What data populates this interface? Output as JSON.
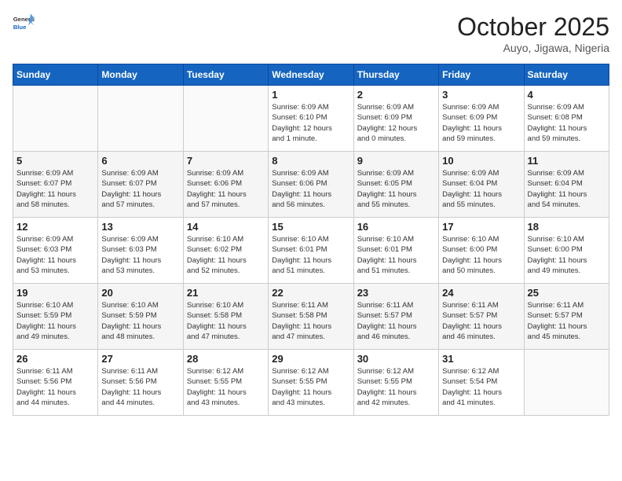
{
  "header": {
    "logo_line1": "General",
    "logo_line2": "Blue",
    "month": "October 2025",
    "location": "Auyo, Jigawa, Nigeria"
  },
  "days_of_week": [
    "Sunday",
    "Monday",
    "Tuesday",
    "Wednesday",
    "Thursday",
    "Friday",
    "Saturday"
  ],
  "weeks": [
    [
      {
        "day": "",
        "info": ""
      },
      {
        "day": "",
        "info": ""
      },
      {
        "day": "",
        "info": ""
      },
      {
        "day": "1",
        "info": "Sunrise: 6:09 AM\nSunset: 6:10 PM\nDaylight: 12 hours\nand 1 minute."
      },
      {
        "day": "2",
        "info": "Sunrise: 6:09 AM\nSunset: 6:09 PM\nDaylight: 12 hours\nand 0 minutes."
      },
      {
        "day": "3",
        "info": "Sunrise: 6:09 AM\nSunset: 6:09 PM\nDaylight: 11 hours\nand 59 minutes."
      },
      {
        "day": "4",
        "info": "Sunrise: 6:09 AM\nSunset: 6:08 PM\nDaylight: 11 hours\nand 59 minutes."
      }
    ],
    [
      {
        "day": "5",
        "info": "Sunrise: 6:09 AM\nSunset: 6:07 PM\nDaylight: 11 hours\nand 58 minutes."
      },
      {
        "day": "6",
        "info": "Sunrise: 6:09 AM\nSunset: 6:07 PM\nDaylight: 11 hours\nand 57 minutes."
      },
      {
        "day": "7",
        "info": "Sunrise: 6:09 AM\nSunset: 6:06 PM\nDaylight: 11 hours\nand 57 minutes."
      },
      {
        "day": "8",
        "info": "Sunrise: 6:09 AM\nSunset: 6:06 PM\nDaylight: 11 hours\nand 56 minutes."
      },
      {
        "day": "9",
        "info": "Sunrise: 6:09 AM\nSunset: 6:05 PM\nDaylight: 11 hours\nand 55 minutes."
      },
      {
        "day": "10",
        "info": "Sunrise: 6:09 AM\nSunset: 6:04 PM\nDaylight: 11 hours\nand 55 minutes."
      },
      {
        "day": "11",
        "info": "Sunrise: 6:09 AM\nSunset: 6:04 PM\nDaylight: 11 hours\nand 54 minutes."
      }
    ],
    [
      {
        "day": "12",
        "info": "Sunrise: 6:09 AM\nSunset: 6:03 PM\nDaylight: 11 hours\nand 53 minutes."
      },
      {
        "day": "13",
        "info": "Sunrise: 6:09 AM\nSunset: 6:03 PM\nDaylight: 11 hours\nand 53 minutes."
      },
      {
        "day": "14",
        "info": "Sunrise: 6:10 AM\nSunset: 6:02 PM\nDaylight: 11 hours\nand 52 minutes."
      },
      {
        "day": "15",
        "info": "Sunrise: 6:10 AM\nSunset: 6:01 PM\nDaylight: 11 hours\nand 51 minutes."
      },
      {
        "day": "16",
        "info": "Sunrise: 6:10 AM\nSunset: 6:01 PM\nDaylight: 11 hours\nand 51 minutes."
      },
      {
        "day": "17",
        "info": "Sunrise: 6:10 AM\nSunset: 6:00 PM\nDaylight: 11 hours\nand 50 minutes."
      },
      {
        "day": "18",
        "info": "Sunrise: 6:10 AM\nSunset: 6:00 PM\nDaylight: 11 hours\nand 49 minutes."
      }
    ],
    [
      {
        "day": "19",
        "info": "Sunrise: 6:10 AM\nSunset: 5:59 PM\nDaylight: 11 hours\nand 49 minutes."
      },
      {
        "day": "20",
        "info": "Sunrise: 6:10 AM\nSunset: 5:59 PM\nDaylight: 11 hours\nand 48 minutes."
      },
      {
        "day": "21",
        "info": "Sunrise: 6:10 AM\nSunset: 5:58 PM\nDaylight: 11 hours\nand 47 minutes."
      },
      {
        "day": "22",
        "info": "Sunrise: 6:11 AM\nSunset: 5:58 PM\nDaylight: 11 hours\nand 47 minutes."
      },
      {
        "day": "23",
        "info": "Sunrise: 6:11 AM\nSunset: 5:57 PM\nDaylight: 11 hours\nand 46 minutes."
      },
      {
        "day": "24",
        "info": "Sunrise: 6:11 AM\nSunset: 5:57 PM\nDaylight: 11 hours\nand 46 minutes."
      },
      {
        "day": "25",
        "info": "Sunrise: 6:11 AM\nSunset: 5:57 PM\nDaylight: 11 hours\nand 45 minutes."
      }
    ],
    [
      {
        "day": "26",
        "info": "Sunrise: 6:11 AM\nSunset: 5:56 PM\nDaylight: 11 hours\nand 44 minutes."
      },
      {
        "day": "27",
        "info": "Sunrise: 6:11 AM\nSunset: 5:56 PM\nDaylight: 11 hours\nand 44 minutes."
      },
      {
        "day": "28",
        "info": "Sunrise: 6:12 AM\nSunset: 5:55 PM\nDaylight: 11 hours\nand 43 minutes."
      },
      {
        "day": "29",
        "info": "Sunrise: 6:12 AM\nSunset: 5:55 PM\nDaylight: 11 hours\nand 43 minutes."
      },
      {
        "day": "30",
        "info": "Sunrise: 6:12 AM\nSunset: 5:55 PM\nDaylight: 11 hours\nand 42 minutes."
      },
      {
        "day": "31",
        "info": "Sunrise: 6:12 AM\nSunset: 5:54 PM\nDaylight: 11 hours\nand 41 minutes."
      },
      {
        "day": "",
        "info": ""
      }
    ]
  ]
}
